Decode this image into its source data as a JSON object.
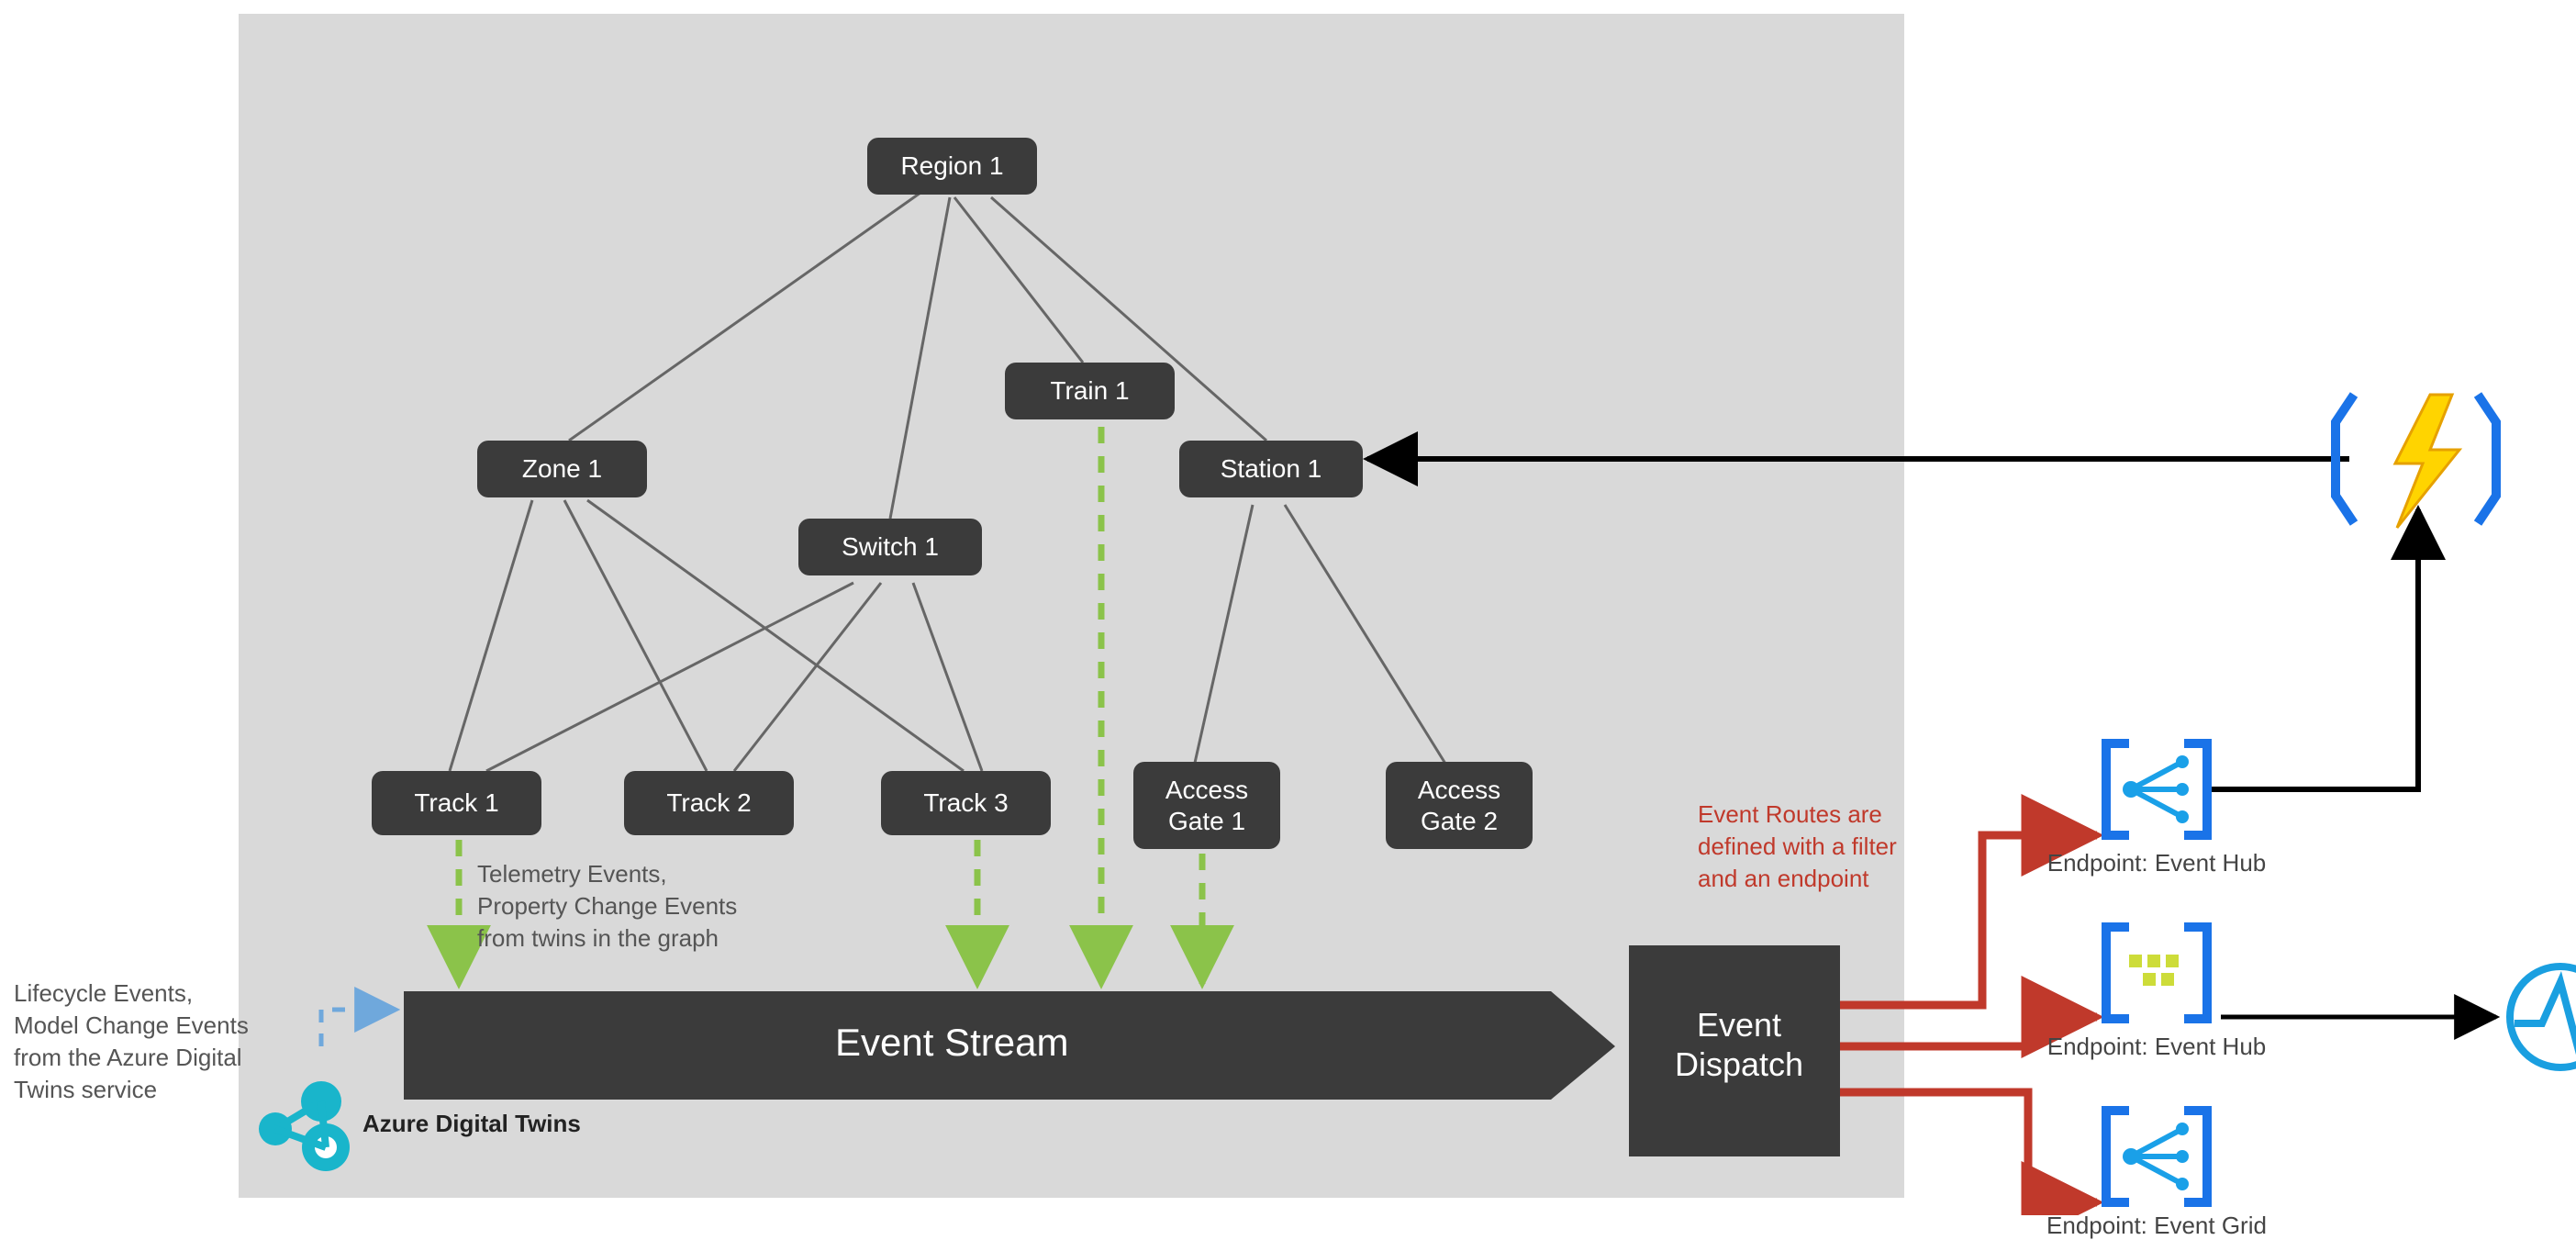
{
  "nodes": {
    "region1": "Region 1",
    "zone1": "Zone 1",
    "train1": "Train 1",
    "station1": "Station 1",
    "switch1": "Switch 1",
    "track1": "Track 1",
    "track2": "Track 2",
    "track3": "Track 3",
    "accessGate1": "Access\nGate 1",
    "accessGate2": "Access\nGate 2"
  },
  "eventStream": "Event Stream",
  "eventDispatch": "Event\nDispatch",
  "telemetryNote": "Telemetry Events,\nProperty Change Events\nfrom twins in the graph",
  "lifecycleNote": "Lifecycle Events,\nModel Change Events\nfrom the Azure Digital\nTwins service",
  "adtLabel": "Azure Digital Twins",
  "routeNote": "Event Routes are\ndefined with a filter\nand an endpoint",
  "endpoints": {
    "eventHub1": "Endpoint: Event Hub",
    "eventHub2": "Endpoint: Event Hub",
    "eventGrid": "Endpoint: Event Grid"
  }
}
